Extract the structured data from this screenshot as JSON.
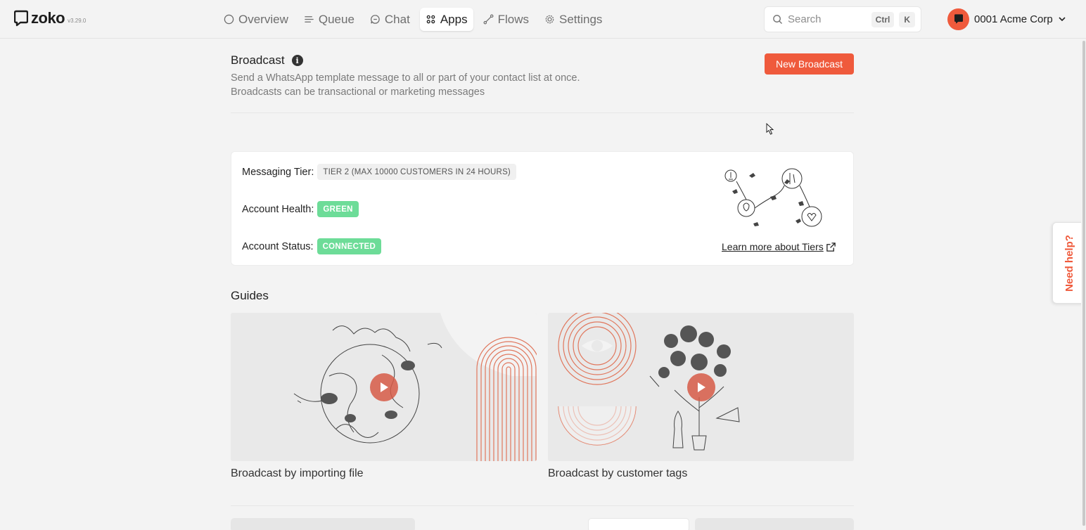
{
  "app": {
    "name": "zoko",
    "version": "v3.29.0"
  },
  "nav": {
    "items": [
      {
        "label": "Overview",
        "icon": "circle-icon"
      },
      {
        "label": "Queue",
        "icon": "queue-list-icon"
      },
      {
        "label": "Chat",
        "icon": "chat-bubble-icon"
      },
      {
        "label": "Apps",
        "icon": "grid-dots-icon",
        "active": true
      },
      {
        "label": "Flows",
        "icon": "flow-path-icon"
      },
      {
        "label": "Settings",
        "icon": "gear-icon"
      }
    ]
  },
  "search": {
    "label": "Search",
    "shortcut_mod": "Ctrl",
    "shortcut_key": "K"
  },
  "account": {
    "name": "0001 Acme Corp"
  },
  "broadcast": {
    "title": "Broadcast",
    "description_line1": "Send a WhatsApp template message to all or part of your contact list at once.",
    "description_line2": "Broadcasts can be transactional or marketing messages",
    "new_button": "New Broadcast"
  },
  "tier_card": {
    "messaging_tier_label": "Messaging Tier:",
    "messaging_tier_value": "TIER 2 (MAX 10000 CUSTOMERS IN 24 HOURS)",
    "account_health_label": "Account Health:",
    "account_health_value": "GREEN",
    "account_status_label": "Account Status:",
    "account_status_value": "CONNECTED",
    "learn_more": "Learn more about Tiers"
  },
  "guides": {
    "title": "Guides",
    "cards": [
      {
        "label": "Broadcast by importing file"
      },
      {
        "label": "Broadcast by customer tags"
      }
    ]
  },
  "help": {
    "label": "Need help?"
  },
  "colors": {
    "accent": "#ef5a3c",
    "success": "#6ddc98",
    "background": "#f3f3f3"
  }
}
